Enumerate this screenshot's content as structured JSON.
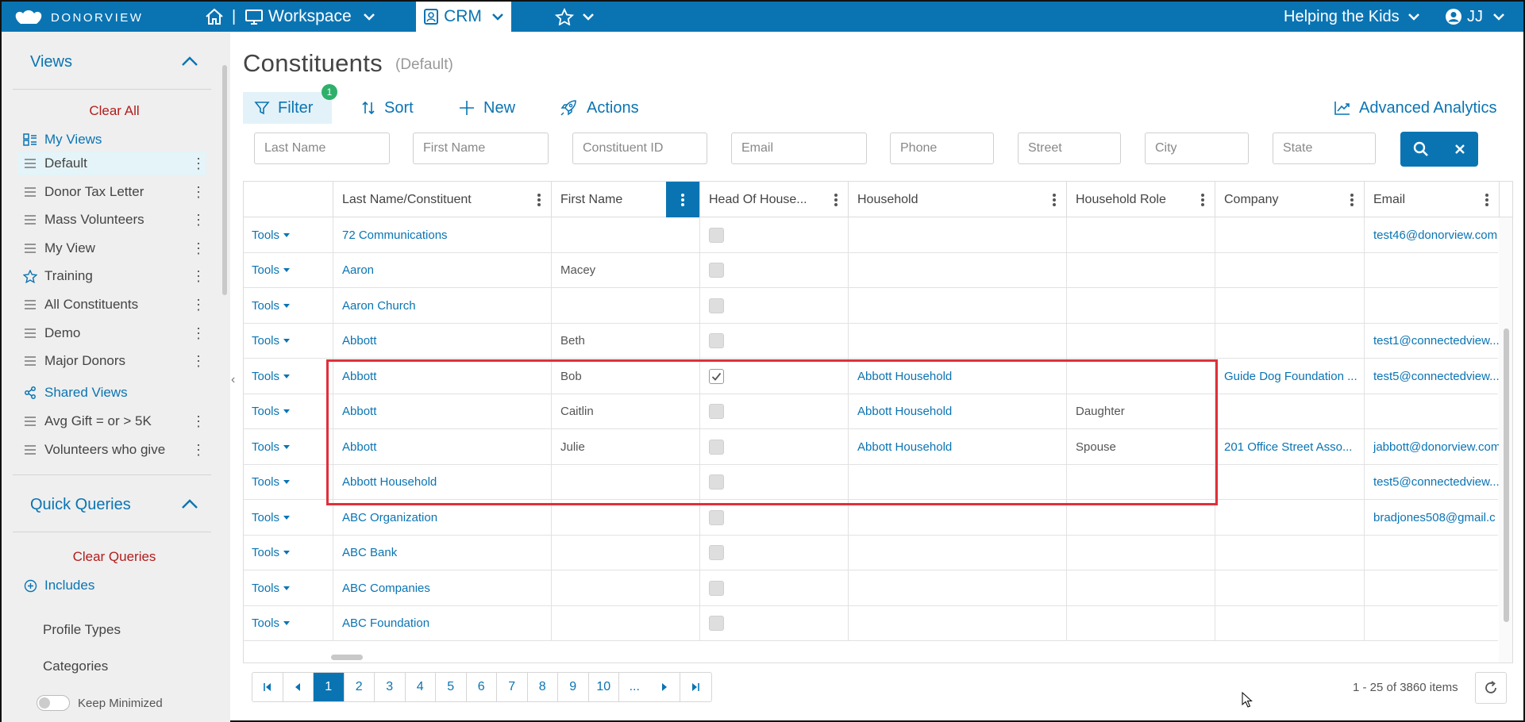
{
  "topbar": {
    "logo_text": "DONORVIEW",
    "separator": "|",
    "workspace_label": "Workspace",
    "crm_label": "CRM",
    "org_label": "Helping the Kids",
    "user_initials": "JJ"
  },
  "sidebar": {
    "views_title": "Views",
    "clear_all": "Clear All",
    "my_views": "My Views",
    "views": [
      {
        "label": "Default",
        "icon": "list-icon",
        "selected": true
      },
      {
        "label": "Donor Tax Letter",
        "icon": "list-icon"
      },
      {
        "label": "Mass Volunteers",
        "icon": "list-icon"
      },
      {
        "label": "My View",
        "icon": "list-icon"
      },
      {
        "label": "Training",
        "icon": "star-icon"
      },
      {
        "label": "All Constituents",
        "icon": "list-icon"
      },
      {
        "label": "Demo",
        "icon": "list-icon"
      },
      {
        "label": "Major Donors",
        "icon": "list-icon"
      }
    ],
    "shared_views": "Shared Views",
    "shared": [
      {
        "label": "Avg Gift = or > 5K"
      },
      {
        "label": "Volunteers who give"
      }
    ],
    "quick_queries_title": "Quick Queries",
    "clear_queries": "Clear Queries",
    "includes": "Includes",
    "query_items": [
      "Profile Types",
      "Categories"
    ],
    "keep_minimized": "Keep Minimized"
  },
  "main": {
    "title": "Constituents",
    "subtitle": "(Default)",
    "toolbar": {
      "filter": "Filter",
      "filter_count": "1",
      "sort": "Sort",
      "new": "New",
      "actions": "Actions",
      "analytics": "Advanced Analytics"
    },
    "filters": {
      "last_name": "Last Name",
      "first_name": "First Name",
      "constituent_id": "Constituent ID",
      "email": "Email",
      "phone": "Phone",
      "street": "Street",
      "city": "City",
      "state": "State"
    }
  },
  "grid": {
    "columns": [
      "Last Name/Constituent",
      "First Name",
      "Head Of House...",
      "Household",
      "Household Role",
      "Company",
      "Email"
    ],
    "tools_label": "Tools",
    "rows": [
      {
        "last": "72 Communications",
        "first": "",
        "head": false,
        "household": "",
        "role": "",
        "company": "",
        "email": "test46@donorview.com"
      },
      {
        "last": "Aaron",
        "first": "Macey",
        "head": false,
        "household": "",
        "role": "",
        "company": "",
        "email": ""
      },
      {
        "last": "Aaron Church",
        "first": "",
        "head": false,
        "household": "",
        "role": "",
        "company": "",
        "email": ""
      },
      {
        "last": "Abbott",
        "first": "Beth",
        "head": false,
        "household": "",
        "role": "",
        "company": "",
        "email": "test1@connectedview..."
      },
      {
        "last": "Abbott",
        "first": "Bob",
        "head": true,
        "household": "Abbott Household",
        "role": "",
        "company": "Guide Dog Foundation ...",
        "email": "test5@connectedview..."
      },
      {
        "last": "Abbott",
        "first": "Caitlin",
        "head": false,
        "household": "Abbott Household",
        "role": "Daughter",
        "company": "",
        "email": ""
      },
      {
        "last": "Abbott",
        "first": "Julie",
        "head": false,
        "household": "Abbott Household",
        "role": "Spouse",
        "company": "201 Office Street Asso...",
        "email": "jabbott@donorview.com"
      },
      {
        "last": "Abbott Household",
        "first": "",
        "head": false,
        "household": "",
        "role": "",
        "company": "",
        "email": "test5@connectedview..."
      },
      {
        "last": "ABC Organization",
        "first": "",
        "head": false,
        "household": "",
        "role": "",
        "company": "",
        "email": "bradjones508@gmail.c"
      },
      {
        "last": "ABC Bank",
        "first": "",
        "head": false,
        "household": "",
        "role": "",
        "company": "",
        "email": ""
      },
      {
        "last": "ABC Companies",
        "first": "",
        "head": false,
        "household": "",
        "role": "",
        "company": "",
        "email": ""
      },
      {
        "last": "ABC Foundation",
        "first": "",
        "head": false,
        "household": "",
        "role": "",
        "company": "",
        "email": ""
      }
    ]
  },
  "pager": {
    "pages": [
      "1",
      "2",
      "3",
      "4",
      "5",
      "6",
      "7",
      "8",
      "9",
      "10",
      "..."
    ],
    "current": "1",
    "summary": "1 - 25 of 3860 items"
  },
  "colors": {
    "brand": "#0a74b3",
    "danger": "#b31c1c",
    "highlight": "#e0303a",
    "badge": "#2eb06a"
  }
}
